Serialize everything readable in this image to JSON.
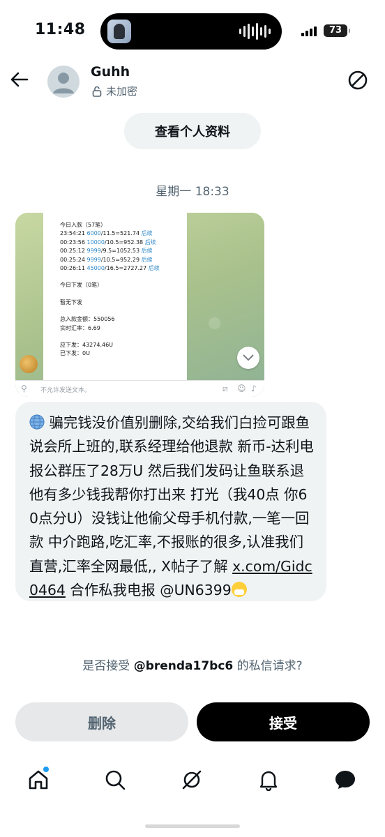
{
  "status_bar": {
    "time": "11:48",
    "battery": "73"
  },
  "header": {
    "name": "Guhh",
    "encryption": "未加密"
  },
  "profile_button": "查看个人资料",
  "date_separator": "星期一 18:33",
  "image_message": {
    "panel": {
      "today_in": "今日入款（57笔）",
      "rows": [
        {
          "time": "23:54:21",
          "amount": "6000",
          "calc": "/11.5=521.74",
          "more": "后续"
        },
        {
          "time": "00:23:56",
          "amount": "10000",
          "calc": "/10.5=952.38",
          "more": "后续"
        },
        {
          "time": "00:25:12",
          "amount": "9999",
          "calc": "/9.5=1052.53",
          "more": "后续"
        },
        {
          "time": "00:25:24",
          "amount": "9999",
          "calc": "/10.5=952.29",
          "more": "后续"
        },
        {
          "time": "00:26:11",
          "amount": "45000",
          "calc": "/16.5=2727.27",
          "more": "后续"
        }
      ],
      "today_out": "今日下发（0笔）",
      "no_out": "暂无下发",
      "total_in": "总入款金额：550056",
      "rate": "实时汇率：6.69",
      "should_out": "应下发：43274.46U",
      "sent": "已下发：0U"
    },
    "input_placeholder": "不允许发送文本。"
  },
  "message_text": {
    "body": "骗完钱没价值别删除,交给我们白捡可跟鱼说会所上班的,联系经理给他退款 新币-达利电报公群压了28万U 然后我们发码让鱼联系退他有多少钱我帮你打出来 打光（我40点 你60点分U）没钱让他偷父母手机付款,一笔一回款 中介跑路,吃汇率,不报账的很多,认准我们直营,汇率全网最低,,  X帖子了解 ",
    "link": "x.com/Gidc0464",
    "tail": " 合作私我电报 @UN6399"
  },
  "request": {
    "prefix": "是否接受 ",
    "handle": "@brenda17bc6",
    "suffix": " 的私信请求?"
  },
  "buttons": {
    "delete": "删除",
    "accept": "接受"
  },
  "icons": {
    "back": "arrow-left-icon",
    "block": "block-icon",
    "lock": "unlock-icon",
    "tabs": [
      "home-icon",
      "search-icon",
      "grok-icon",
      "notifications-icon",
      "messages-icon"
    ]
  },
  "colors": {
    "accent": "#1d9bf0",
    "bubble": "#eff3f4",
    "accept_bg": "#000000",
    "delete_bg": "#e6e8ea"
  }
}
